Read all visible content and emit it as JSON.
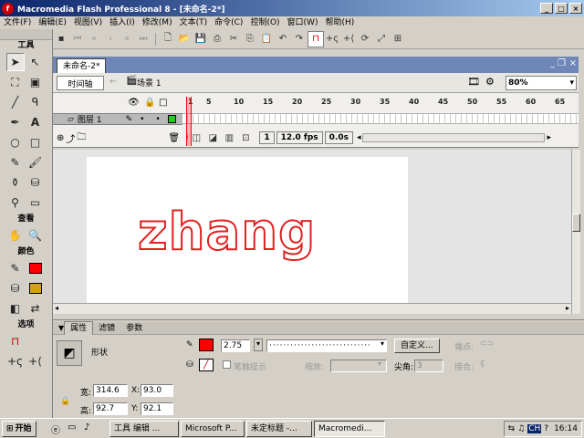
{
  "window": {
    "title": "Macromedia Flash Professional 8 - [未命名-2*]"
  },
  "menu": [
    "文件(F)",
    "编辑(E)",
    "视图(V)",
    "插入(I)",
    "修改(M)",
    "文本(T)",
    "命令(C)",
    "控制(O)",
    "窗口(W)",
    "帮助(H)"
  ],
  "tools": {
    "title": "工具",
    "view_title": "查看",
    "color_title": "颜色",
    "options_title": "选项",
    "stroke_color": "#ff0000",
    "fill_color": "#d4a017"
  },
  "document": {
    "tab": "未命名-2*",
    "timeline_label": "时间轴",
    "scene": "场景 1",
    "zoom": "80%"
  },
  "timeline": {
    "ruler": [
      "1",
      "5",
      "10",
      "15",
      "20",
      "25",
      "30",
      "35",
      "40",
      "45",
      "50",
      "55",
      "60",
      "65"
    ],
    "layer_name": "图层 1",
    "frame": "1",
    "fps": "12.0 fps",
    "time": "0.0s"
  },
  "stage": {
    "text": "zhang"
  },
  "properties": {
    "tabs": [
      "属性",
      "滤镜",
      "参数"
    ],
    "shape_label": "形状",
    "stroke_width": "2.75",
    "custom_btn": "自定义...",
    "endpoint_label": "端点:",
    "hint_label": "笔触提示",
    "scale_label": "缩放:",
    "corner_label": "尖角:",
    "corner_value": "3",
    "join_label": "接合:",
    "width_label": "宽:",
    "width": "314.6",
    "height_label": "高:",
    "height": "92.7",
    "x_label": "X:",
    "x": "93.0",
    "y_label": "Y:",
    "y": "92.1"
  },
  "taskbar": {
    "start": "开始",
    "tasks": [
      "工具 编辑 ...",
      "Microsoft P...",
      "未定标题 -...",
      "Macromedi..."
    ],
    "time": "16:14"
  }
}
